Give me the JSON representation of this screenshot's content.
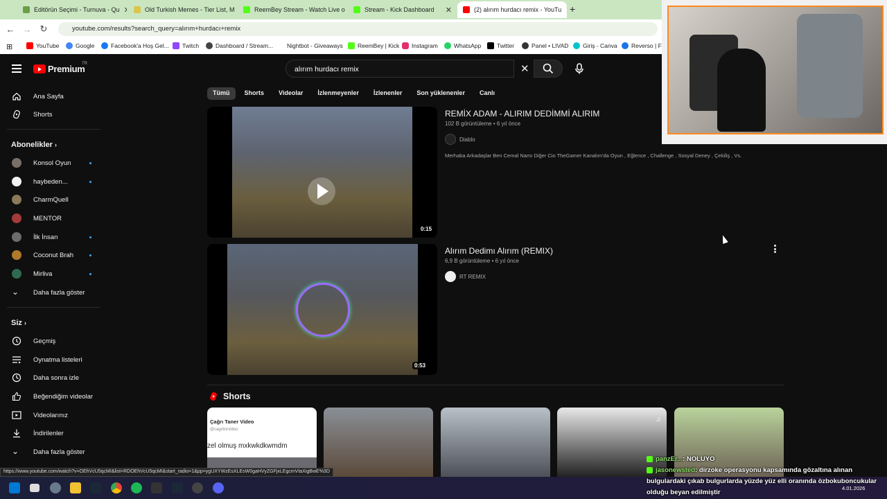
{
  "browser": {
    "tabs": [
      {
        "title": "Editörün Seçimi - Turnuva - Qu",
        "color": "#6b9e47"
      },
      {
        "title": "Old Turkish Memes - Tier List, M",
        "color": "#d9c64b"
      },
      {
        "title": "ReemBey Stream - Watch Live o",
        "color": "#53fc18"
      },
      {
        "title": "Stream - Kick Dashboard",
        "color": "#53fc18"
      },
      {
        "title": "(2) alırım hurdacı remix - YouTu",
        "color": "#ff0000"
      }
    ],
    "new_tab": "+",
    "url": "youtube.com/results?search_query=alırım+hurdacı+remix",
    "bookmarks": [
      {
        "label": "YouTube",
        "color": "#ff0000"
      },
      {
        "label": "Google",
        "color": "#4285f4"
      },
      {
        "label": "Facebook'a Hoş Gel...",
        "color": "#1877f2"
      },
      {
        "label": "Twitch",
        "color": "#9146ff"
      },
      {
        "label": "Dashboard / Stream...",
        "color": "#444444"
      },
      {
        "label": "Nightbot - Giveaways",
        "color": "#ffffff"
      },
      {
        "label": "ReemBey | Kick",
        "color": "#53fc18"
      },
      {
        "label": "Instagram",
        "color": "#e1306c"
      },
      {
        "label": "WhatsApp",
        "color": "#25d366"
      },
      {
        "label": "Twitter",
        "color": "#000000"
      },
      {
        "label": "Panel • LIVAD",
        "color": "#333333"
      },
      {
        "label": "Giriş - Canva",
        "color": "#00c4cc"
      },
      {
        "label": "Reverso | Fre",
        "color": "#1a73e8"
      }
    ]
  },
  "youtube": {
    "logo_text": "Premium",
    "logo_region": "TR",
    "search_value": "alırım hurdacı remix",
    "chips": [
      "Tümü",
      "Shorts",
      "Videolar",
      "İzlenmeyenler",
      "İzlenenler",
      "Son yüklenenler",
      "Canlı"
    ],
    "sidebar": {
      "main": [
        {
          "label": "Ana Sayfa",
          "icon": "home-icon"
        },
        {
          "label": "Shorts",
          "icon": "shorts-icon"
        }
      ],
      "subs_header": "Abonelikler",
      "subscriptions": [
        {
          "label": "Konsol Oyun",
          "color": "#7a6f66",
          "live": true
        },
        {
          "label": "haybeden...",
          "color": "#f2f2f2",
          "live": true
        },
        {
          "label": "CharmQuell",
          "color": "#8a7a5a",
          "live": false
        },
        {
          "label": "MENTOR",
          "color": "#a33a3a",
          "live": false
        },
        {
          "label": "İlk İnsan",
          "color": "#6c6c6c",
          "live": true
        },
        {
          "label": "Coconut Brah",
          "color": "#b07a2a",
          "live": true
        },
        {
          "label": "Mirliva",
          "color": "#2f6a4f",
          "live": true
        }
      ],
      "show_more": "Daha fazla göster",
      "you_header": "Siz",
      "you_items": [
        {
          "label": "Geçmiş",
          "icon": "history-icon"
        },
        {
          "label": "Oynatma listeleri",
          "icon": "playlists-icon"
        },
        {
          "label": "Daha sonra izle",
          "icon": "watch-later-icon"
        },
        {
          "label": "Beğendiğim videolar",
          "icon": "like-icon"
        },
        {
          "label": "Videolarınız",
          "icon": "your-videos-icon"
        },
        {
          "label": "İndirilenler",
          "icon": "download-icon"
        }
      ],
      "show_more_2": "Daha fazla göster"
    },
    "results": [
      {
        "title": "REMİX ADAM - ALIRIM DEDİMMİ ALIRIM",
        "meta": "102 B görüntüleme • 6 yıl önce",
        "channel": "Diablo",
        "description": "Merhaba Arkadaşlar Ben Cemal Namı Diğer Cio TheGamer Kanalım'da Oyun , Eğlence , Challenge , Sosyal Deney , Çekiliş , Vs.",
        "duration": "0:15"
      },
      {
        "title": "Alırım Dedimı Alırım (REMIX)",
        "meta": "6,9 B görüntüleme • 6 yıl önce",
        "channel": "RT REMIX",
        "duration": "0:53"
      }
    ],
    "shorts_header": "Shorts",
    "short_card_1": {
      "name": "Çağrı Taner Video",
      "handle": "@cagritnrvideo",
      "caption": "zel olmuş mxkwkdkwmdm"
    }
  },
  "status_url": "https://www.youtube.com/watch?v=OEhVcU5qcMI&list=RDOEhVcU5qcMI&start_radio=1&pp=ygUXYWzEsXLEsW0gaHVyZGFjxLEgcmVtaXigBwE%3D",
  "chat": [
    {
      "user": "panzEr...",
      "text": ": NOLUYO"
    },
    {
      "user": "jasonewsted",
      "text": ": dirzoke operasyonu kapsamında gözaltına alınan bulgulardaki çıkab bulgurlarda yüzde yüz elli oranında özbokuboncukular olduğu beyan edilmiştir"
    }
  ],
  "clock": "4.01.2026"
}
